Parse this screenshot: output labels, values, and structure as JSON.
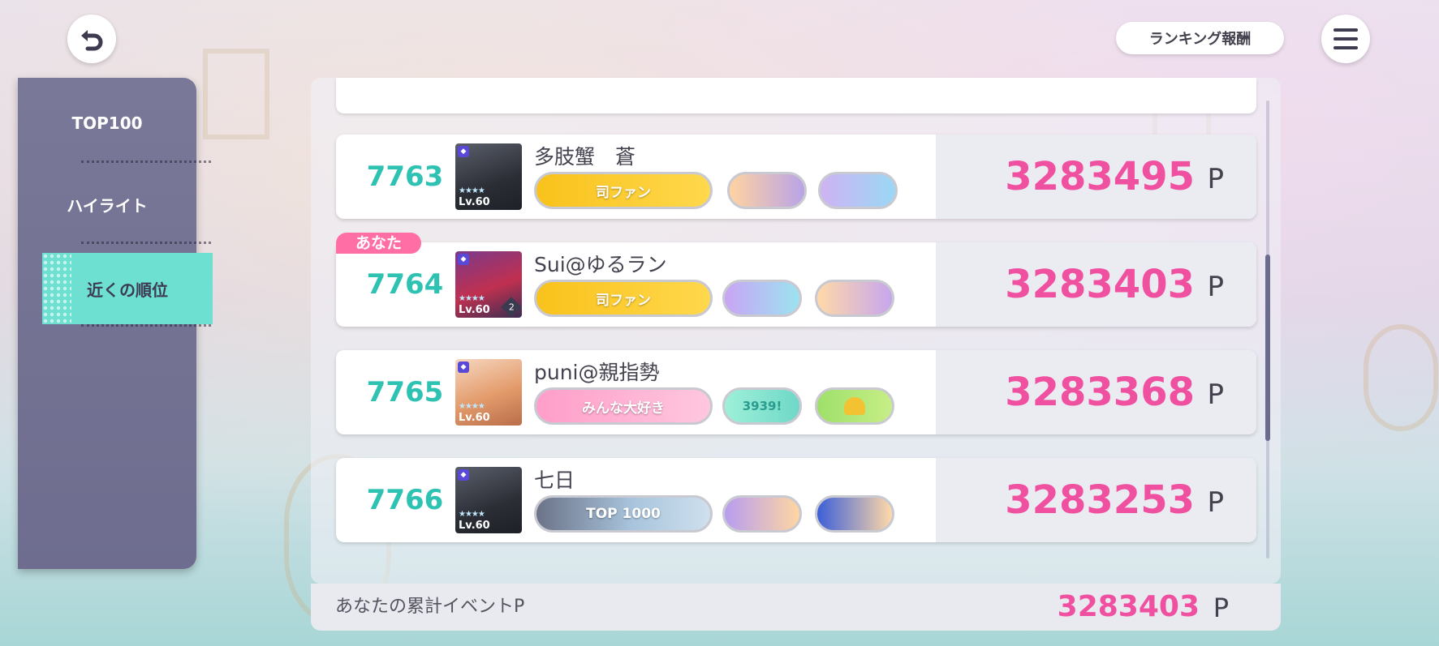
{
  "header": {
    "back_icon": "back-arrow-icon",
    "ranking_reward_label": "ランキング報酬",
    "menu_icon": "hamburger-menu-icon"
  },
  "sidebar": {
    "tabs": [
      {
        "label": "TOP100",
        "active": false
      },
      {
        "label": "ハイライト",
        "active": false
      },
      {
        "label": "近くの順位",
        "active": true
      }
    ]
  },
  "ranking": {
    "you_tag": "あなた",
    "unit": "P",
    "rows": [
      {
        "rank": "7763",
        "name": "多肢蟹　蒼",
        "level": "Lv.60",
        "honor_main": "司ファン",
        "score": "3283495",
        "is_you": false
      },
      {
        "rank": "7764",
        "name": "Sui@ゆるラン",
        "level": "Lv.60",
        "master_rank": "2",
        "honor_main": "司ファン",
        "score": "3283403",
        "is_you": true
      },
      {
        "rank": "7765",
        "name": "puni@親指勢",
        "level": "Lv.60",
        "honor_main": "みんな大好き",
        "honor_second": "3939!",
        "score": "3283368",
        "is_you": false
      },
      {
        "rank": "7766",
        "name": "七日",
        "level": "Lv.60",
        "honor_main": "TOP 1000",
        "score": "3283253",
        "is_you": false
      }
    ]
  },
  "footer": {
    "label": "あなたの累計イベントP",
    "score": "3283403",
    "unit": "P"
  },
  "colors": {
    "accent_teal": "#2ec2b3",
    "score_pink": "#f050a0",
    "sidebar_bg": "#7a7898",
    "active_tab": "#6ee0d2"
  }
}
